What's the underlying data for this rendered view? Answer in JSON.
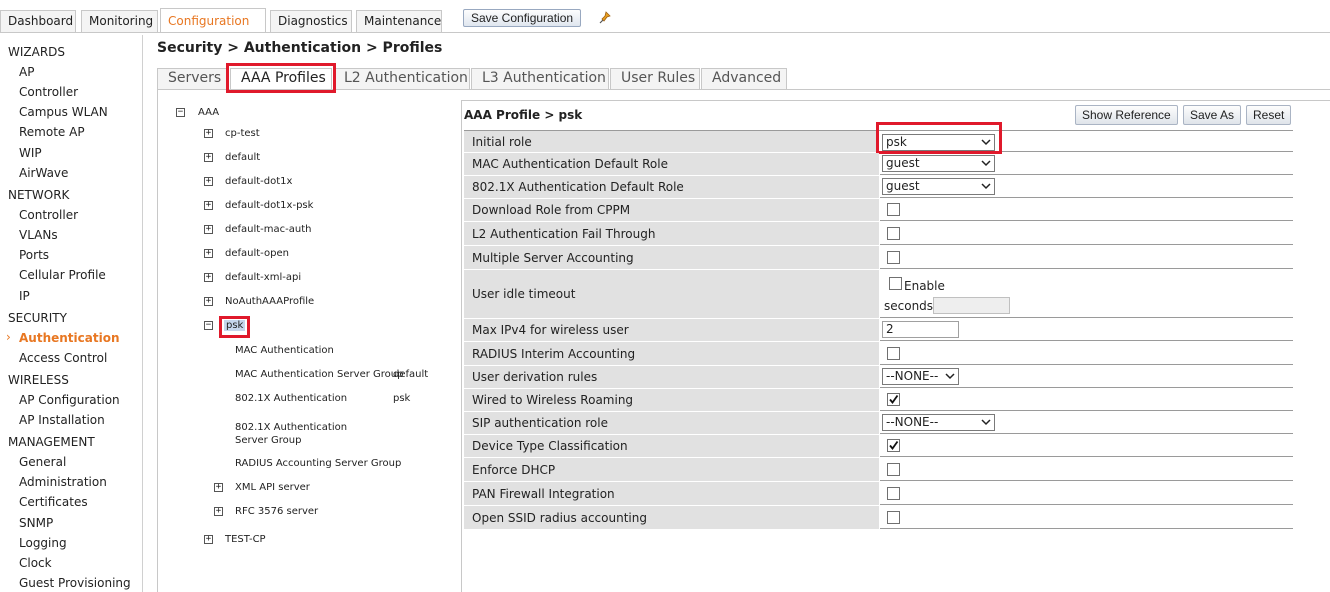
{
  "top_nav": {
    "tabs": [
      "Dashboard",
      "Monitoring",
      "Configuration",
      "Diagnostics",
      "Maintenance"
    ],
    "active_tab": "Configuration",
    "save_configuration": "Save Configuration"
  },
  "sidebar": {
    "sections": [
      {
        "title": "WIZARDS",
        "items": [
          "AP",
          "Controller",
          "Campus WLAN",
          "Remote AP",
          "WIP",
          "AirWave"
        ]
      },
      {
        "title": "NETWORK",
        "items": [
          "Controller",
          "VLANs",
          "Ports",
          "Cellular Profile",
          "IP"
        ]
      },
      {
        "title": "SECURITY",
        "items": [
          "Authentication",
          "Access Control"
        ]
      },
      {
        "title": "WIRELESS",
        "items": [
          "AP Configuration",
          "AP Installation"
        ]
      },
      {
        "title": "MANAGEMENT",
        "items": [
          "General",
          "Administration",
          "Certificates",
          "SNMP",
          "Logging",
          "Clock",
          "Guest Provisioning"
        ]
      }
    ],
    "active_item": "Authentication"
  },
  "breadcrumb": "Security > Authentication > Profiles",
  "sub_tabs": [
    "Servers",
    "AAA Profiles",
    "L2 Authentication",
    "L3 Authentication",
    "User Rules",
    "Advanced"
  ],
  "active_sub_tab": "AAA Profiles",
  "tree": {
    "root": "AAA",
    "profiles": [
      "cp-test",
      "default",
      "default-dot1x",
      "default-dot1x-psk",
      "default-mac-auth",
      "default-open",
      "default-xml-api",
      "NoAuthAAAProfile"
    ],
    "expanded": "psk",
    "children": [
      {
        "label": "MAC Authentication",
        "value": ""
      },
      {
        "label": "MAC Authentication Server Group",
        "value": "default"
      },
      {
        "label": "802.1X Authentication",
        "value": "psk"
      },
      {
        "label": "802.1X Authentication Server Group",
        "value": ""
      },
      {
        "label": "RADIUS Accounting Server Group",
        "value": ""
      }
    ],
    "sub_nodes": [
      "XML API server",
      "RFC 3576 server"
    ],
    "last": "TEST-CP"
  },
  "profile": {
    "title": "AAA Profile > psk",
    "buttons": {
      "show_reference": "Show Reference",
      "save_as": "Save As",
      "reset": "Reset"
    },
    "rows": {
      "initial_role": {
        "label": "Initial role",
        "value": "psk"
      },
      "mac_default_role": {
        "label": "MAC Authentication Default Role",
        "value": "guest"
      },
      "dot1x_default_role": {
        "label": "802.1X Authentication Default Role",
        "value": "guest"
      },
      "download_role": {
        "label": "Download Role from CPPM",
        "checked": false
      },
      "l2_fail_through": {
        "label": "L2 Authentication Fail Through",
        "checked": false
      },
      "multi_server_acct": {
        "label": "Multiple Server Accounting",
        "checked": false
      },
      "idle_timeout": {
        "label": "User idle timeout",
        "enable_label": "Enable",
        "checked": false,
        "seconds_label": "seconds",
        "seconds_value": ""
      },
      "max_ipv4": {
        "label": "Max IPv4 for wireless user",
        "value": "2"
      },
      "radius_interim": {
        "label": "RADIUS Interim Accounting",
        "checked": false
      },
      "user_derivation": {
        "label": "User derivation rules",
        "value": "--NONE--"
      },
      "wired_roaming": {
        "label": "Wired to Wireless Roaming",
        "checked": true
      },
      "sip_role": {
        "label": "SIP authentication role",
        "value": "--NONE--"
      },
      "device_type": {
        "label": "Device Type Classification",
        "checked": true
      },
      "enforce_dhcp": {
        "label": "Enforce DHCP",
        "checked": false
      },
      "pan_firewall": {
        "label": "PAN Firewall Integration",
        "checked": false
      },
      "open_ssid_radius": {
        "label": "Open SSID radius accounting",
        "checked": false
      }
    }
  },
  "colors": {
    "accent": "#e87722",
    "highlight_box": "#e0192b",
    "label_bg": "#e1e1e1"
  }
}
